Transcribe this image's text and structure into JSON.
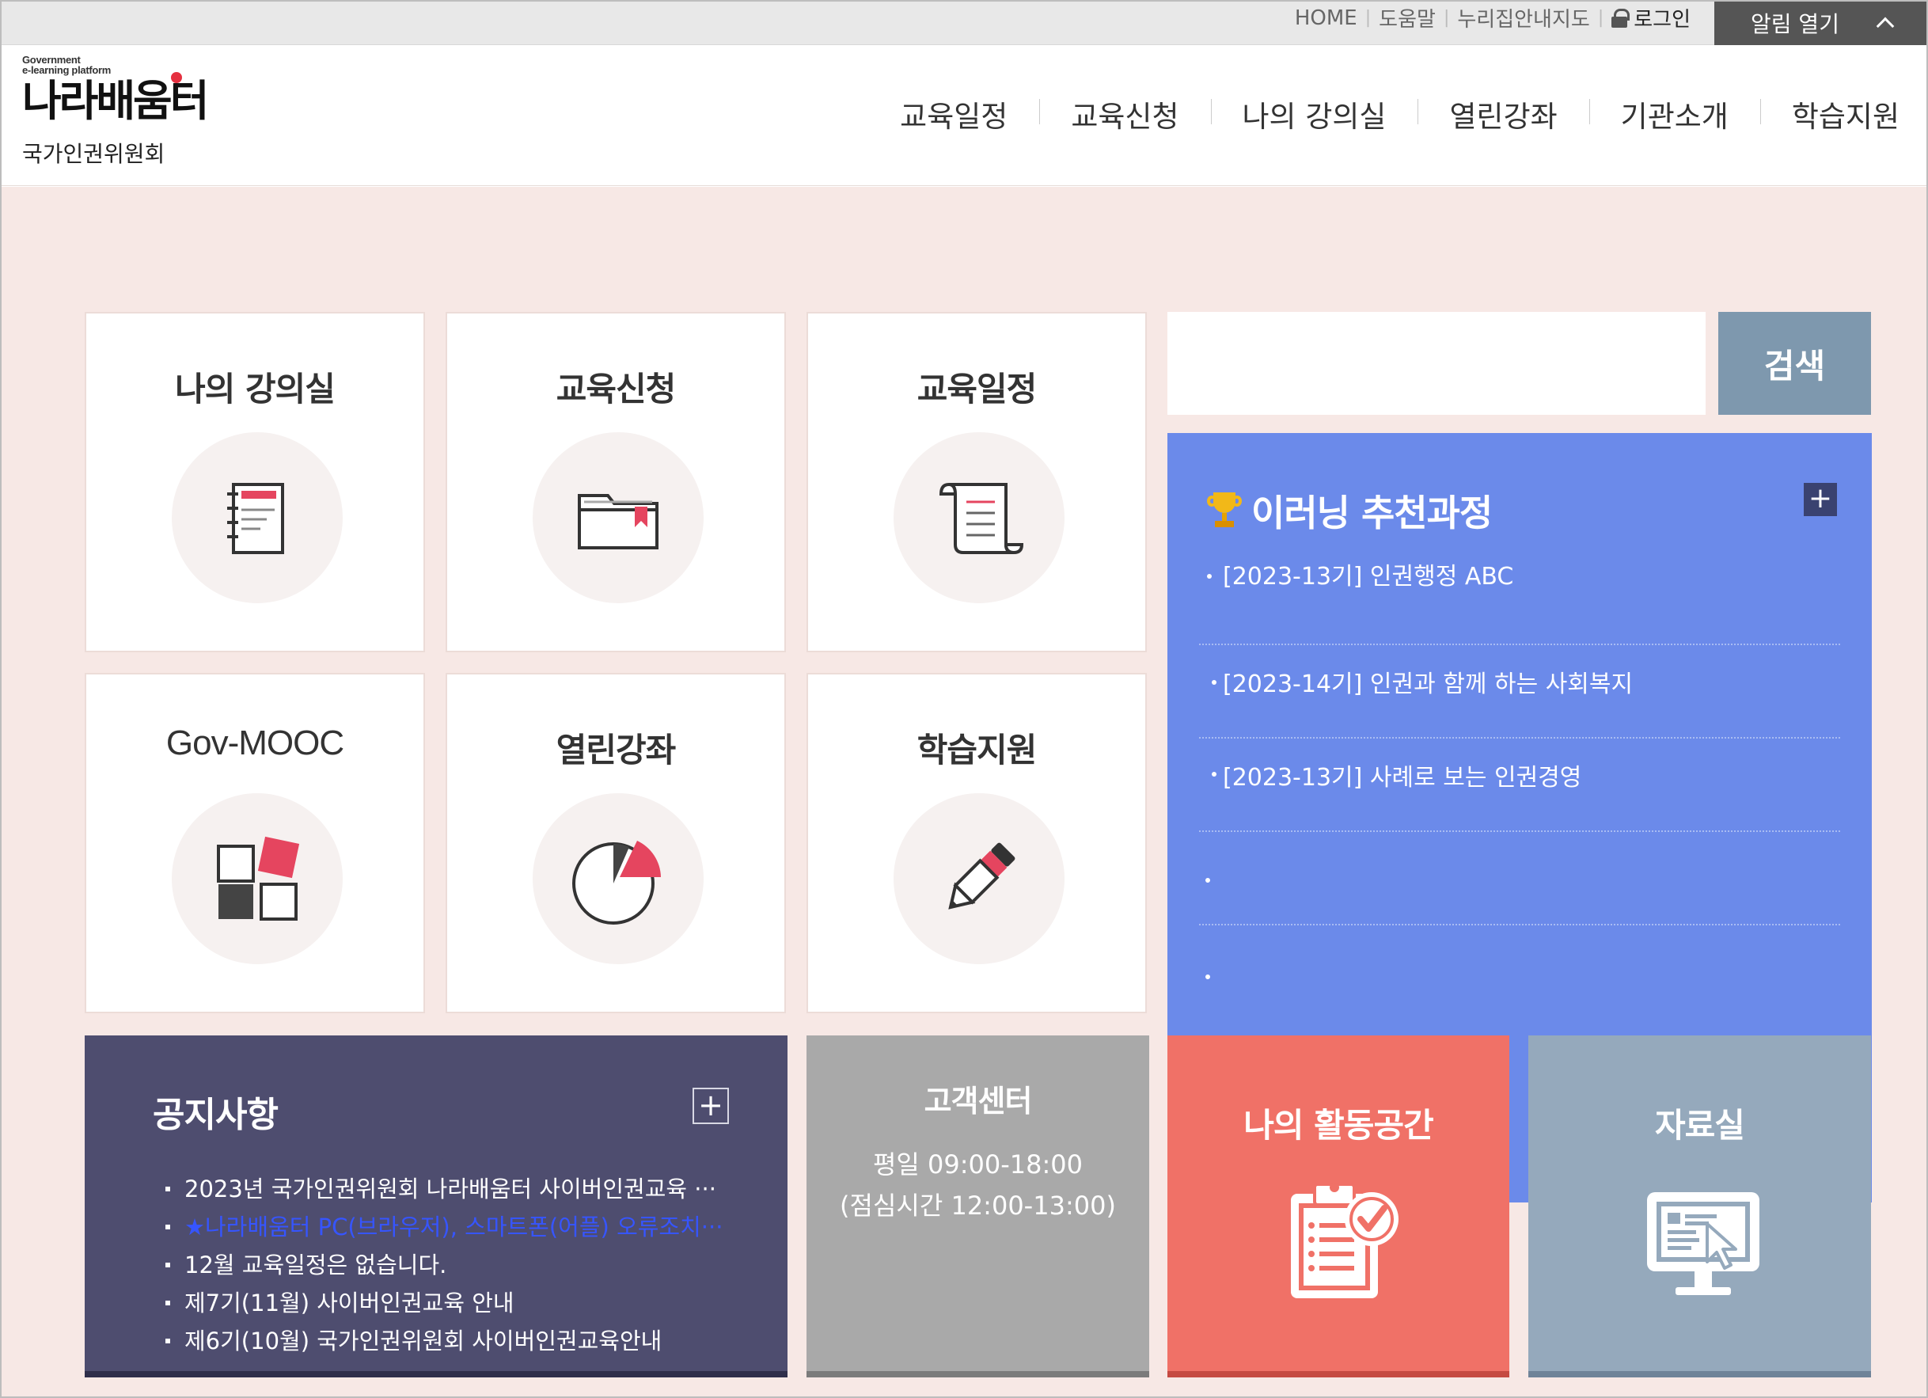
{
  "topbar": {
    "links": [
      "HOME",
      "도움말",
      "누리집안내지도"
    ],
    "login_label": "로그인",
    "alarm_label": "알림 열기"
  },
  "header": {
    "logo_sub_line1": "Government",
    "logo_sub_line2": "e-learning platform",
    "logo_main": "나라배움터",
    "org_name": "국가인권위원회",
    "nav": [
      "교육일정",
      "교육신청",
      "나의 강의실",
      "열린강좌",
      "기관소개",
      "학습지원"
    ]
  },
  "tiles": [
    {
      "title": "나의 강의실",
      "icon": "notebook-icon"
    },
    {
      "title": "교육신청",
      "icon": "folder-icon"
    },
    {
      "title": "교육일정",
      "icon": "scroll-icon"
    },
    {
      "title": "Gov-MOOC",
      "icon": "blocks-icon"
    },
    {
      "title": "열린강좌",
      "icon": "pie-chart-icon"
    },
    {
      "title": "학습지원",
      "icon": "pencil-icon"
    }
  ],
  "search": {
    "button_label": "검색",
    "value": ""
  },
  "recommend": {
    "title": "이러닝 추천과정",
    "items": [
      "[2023-13기] 인권행정 ABC",
      "[2023-14기] 인권과 함께 하는 사회복지",
      "[2023-13기] 사례로 보는 인권경영",
      "",
      ""
    ]
  },
  "notice": {
    "title": "공지사항",
    "items": [
      "2023년 국가인권위원회 나라배움터 사이버인권교육 ···",
      "★나라배움터 PC(브라우저), 스마트폰(어플) 오류조치···",
      "12월 교육일정은 없습니다.",
      "제7기(11월) 사이버인권교육 안내",
      "제6기(10월) 국가인권위원회 사이버인권교육안내"
    ]
  },
  "support": {
    "title": "고객센터",
    "hours_line1": "평일 09:00-18:00",
    "hours_line2": "(점심시간 12:00-13:00)"
  },
  "activity": {
    "title": "나의 활동공간"
  },
  "archive": {
    "title": "자료실"
  },
  "colors": {
    "recommend_bg": "#6b8aea",
    "notice_bg": "#4e4d6f",
    "support_bg": "#a9a9a9",
    "activity_bg": "#f07167",
    "archive_bg": "#95a9bc",
    "search_button_bg": "#7e98ae",
    "icon_accent": "#e5455f",
    "main_bg": "#f7e8e5"
  }
}
